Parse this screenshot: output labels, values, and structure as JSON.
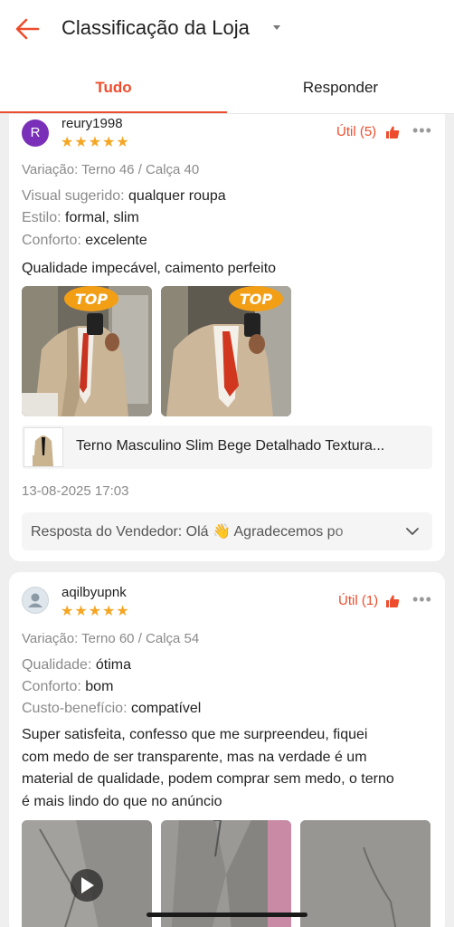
{
  "header": {
    "title": "Classificação da Loja"
  },
  "tabs": [
    {
      "label": "Tudo",
      "active": true
    },
    {
      "label": "Responder",
      "active": false
    }
  ],
  "reviews": [
    {
      "avatar_letter": "R",
      "username": "reury1998",
      "stars": "★★★★★",
      "util": "Útil (5)",
      "variation": "Variação: Terno 46 / Calça 40",
      "attributes": [
        {
          "key": "Visual sugerido:",
          "value": "qualquer roupa"
        },
        {
          "key": "Estilo:",
          "value": "formal, slim"
        },
        {
          "key": "Conforto:",
          "value": "excelente"
        }
      ],
      "text": "Qualidade impecável, caimento perfeito",
      "photo_badge": "TOP",
      "product_name": "Terno Masculino Slim Bege Detalhado Textura...",
      "date": "13-08-2025 17:03",
      "seller_reply": "Resposta do Vendedor: Olá 👋 Agradecemos po"
    },
    {
      "username": "aqilbyupnk",
      "stars": "★★★★★",
      "util": "Útil (1)",
      "variation": "Variação: Terno 60 / Calça 54",
      "attributes": [
        {
          "key": "Qualidade:",
          "value": "ótima"
        },
        {
          "key": "Conforto:",
          "value": "bom"
        },
        {
          "key": "Custo-benefício:",
          "value": "compatível"
        }
      ],
      "text_lines": [
        "Super satisfeita, confesso que me surpreendeu, fiquei",
        "com medo de ser transparente, mas na verdade é um",
        "material de qualidade, podem comprar sem medo, o terno",
        "é mais lindo do que no anúncio"
      ]
    }
  ],
  "colors": {
    "accent": "#ee4d2d",
    "stars": "#f5a623",
    "avatar": "#7a2fb8"
  },
  "icons": [
    "back-arrow-icon",
    "dropdown-caret-icon",
    "thumbs-up-icon",
    "more-options-icon",
    "chevron-down-icon",
    "play-icon",
    "user-icon"
  ]
}
